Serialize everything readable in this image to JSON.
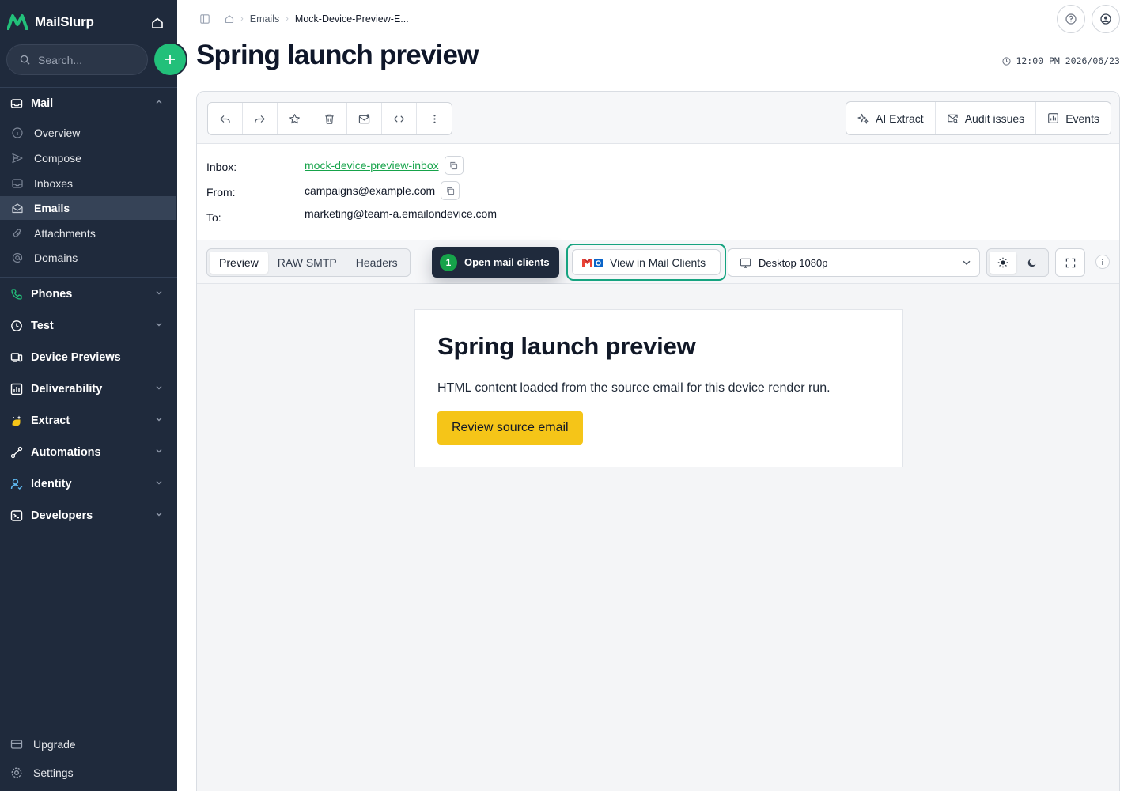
{
  "sidebar": {
    "brand": "MailSlurp",
    "search_placeholder": "Search...",
    "mail_group": "Mail",
    "mail_items": [
      {
        "label": "Overview"
      },
      {
        "label": "Compose"
      },
      {
        "label": "Inboxes"
      },
      {
        "label": "Emails"
      },
      {
        "label": "Attachments"
      },
      {
        "label": "Domains"
      }
    ],
    "groups": [
      {
        "label": "Phones"
      },
      {
        "label": "Test"
      },
      {
        "label": "Device Previews"
      },
      {
        "label": "Deliverability"
      },
      {
        "label": "Extract"
      },
      {
        "label": "Automations"
      },
      {
        "label": "Identity"
      },
      {
        "label": "Developers"
      }
    ],
    "footer": [
      {
        "label": "Upgrade"
      },
      {
        "label": "Settings"
      }
    ]
  },
  "breadcrumb": {
    "emails": "Emails",
    "current": "Mock-Device-Preview-E..."
  },
  "page": {
    "title": "Spring launch preview",
    "timestamp": "12:00 PM 2026/06/23"
  },
  "toolbar": {
    "ai_extract": "AI Extract",
    "audit_issues": "Audit issues",
    "events": "Events"
  },
  "meta": {
    "inbox_label": "Inbox:",
    "inbox_value": "mock-device-preview-inbox",
    "from_label": "From:",
    "from_value": "campaigns@example.com",
    "to_label": "To:",
    "to_value": "marketing@team-a.emailondevice.com"
  },
  "viewbar": {
    "tabs": [
      "Preview",
      "RAW SMTP",
      "Headers"
    ],
    "tour_step": "1",
    "tour_label": "Open mail clients",
    "mail_clients_label": "View in Mail Clients",
    "device_selected": "Desktop 1080p"
  },
  "email": {
    "title": "Spring launch preview",
    "body": "HTML content loaded from the source email for this device render run.",
    "cta": "Review source email"
  },
  "colors": {
    "sidebar_bg": "#1f2a3c",
    "accent_green": "#22c07a",
    "link_green": "#16a34a",
    "highlight_outline": "#16a380",
    "cta_yellow": "#f5c518"
  }
}
